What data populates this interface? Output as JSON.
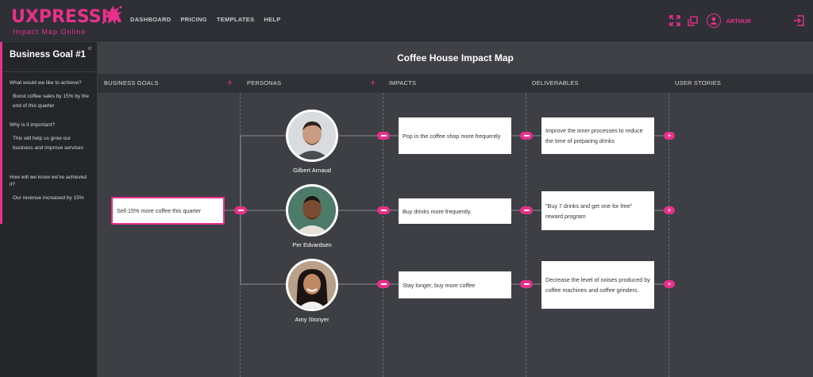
{
  "app": {
    "logo": "UXPRESSIA",
    "logo_sub": "Impact Map Online",
    "nav": [
      "DASHBOARD",
      "PRICING",
      "TEMPLATES",
      "HELP"
    ],
    "user": "ARTHUR",
    "icons": [
      "expand-icon",
      "copy-icon",
      "user-icon",
      "logout-icon"
    ],
    "accent": "#e8308a"
  },
  "sidebar": {
    "collapse": "«",
    "title": "Business Goal #1",
    "q1": "What would we like to achieve?",
    "a1": "Boost coffee sales by 15% by the end of this quarter",
    "q2": "Why is it important?",
    "a2": "This will help us grow our business and improve services",
    "q3": "How will we know we've achieved it?",
    "a3": "Our revenue increased by 15%"
  },
  "map": {
    "title": "Coffee House Impact Map",
    "columns": [
      "BUSINESS GOALS",
      "PERSONAS",
      "IMPACTS",
      "DELIVERABLES",
      "USER STORIES"
    ],
    "goal": "Sell 15% more coffee this quarter",
    "personas": [
      "Gilbert Arnaud",
      "Per Edvardsen",
      "Amy Stonyer"
    ],
    "impacts": [
      "Pop in the coffee shop more frequently",
      "Buy drinks more frequently.",
      "Stay longer, buy more coffee"
    ],
    "deliverables": [
      "Improve the inner processes to reduce the time of preparing drinks",
      "\"Buy 7 drinks and get one for free\" reward program",
      "Decrease the level of noises produced by coffee machines and coffee grinders."
    ]
  }
}
